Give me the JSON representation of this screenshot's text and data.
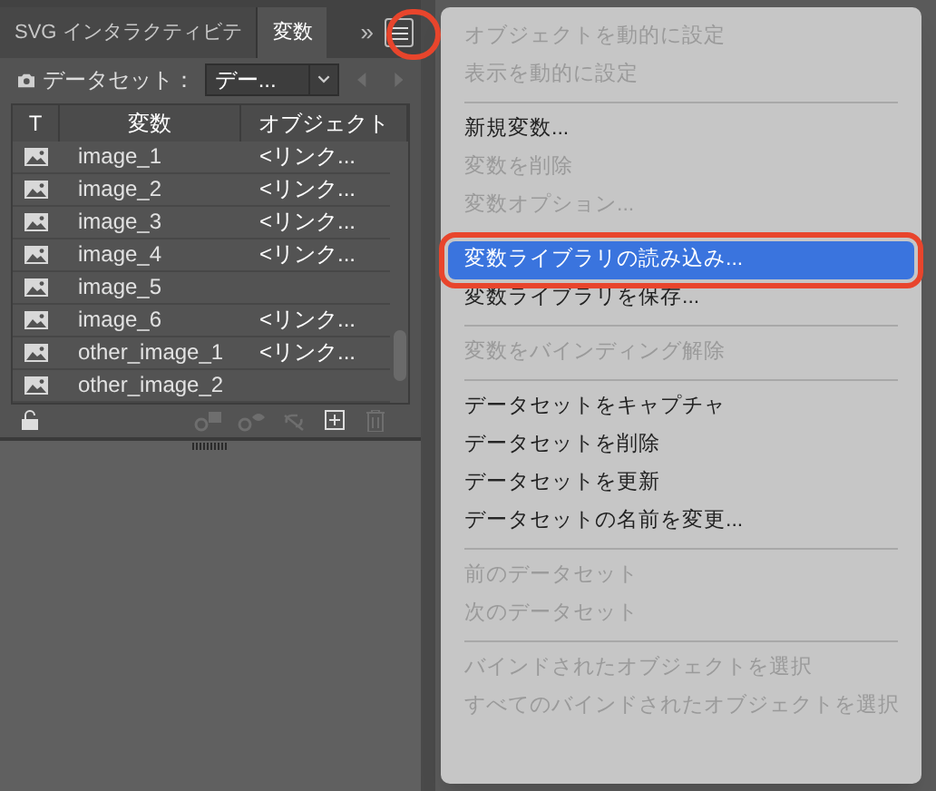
{
  "panel": {
    "tabs": [
      {
        "label": "SVG インタラクティビテ",
        "selected": false
      },
      {
        "label": "変数",
        "selected": true
      }
    ],
    "overflow": "»",
    "dataset": {
      "label": "データセット：",
      "value": "デー..."
    },
    "columns": [
      "T",
      "変数",
      "オブジェクト"
    ],
    "rows": [
      {
        "name": "image_1",
        "object": "<リンク..."
      },
      {
        "name": "image_2",
        "object": "<リンク..."
      },
      {
        "name": "image_3",
        "object": "<リンク..."
      },
      {
        "name": "image_4",
        "object": "<リンク..."
      },
      {
        "name": "image_5",
        "object": ""
      },
      {
        "name": "image_6",
        "object": "<リンク..."
      },
      {
        "name": "other_image_1",
        "object": "<リンク..."
      },
      {
        "name": "other_image_2",
        "object": ""
      }
    ]
  },
  "menu": {
    "groups": [
      [
        {
          "label": "オブジェクトを動的に設定",
          "disabled": true,
          "selected": false
        },
        {
          "label": "表示を動的に設定",
          "disabled": true,
          "selected": false
        }
      ],
      [
        {
          "label": "新規変数...",
          "disabled": false,
          "selected": false
        },
        {
          "label": "変数を削除",
          "disabled": true,
          "selected": false
        },
        {
          "label": "変数オプション...",
          "disabled": true,
          "selected": false
        }
      ],
      [
        {
          "label": "変数ライブラリの読み込み...",
          "disabled": false,
          "selected": true
        },
        {
          "label": "変数ライブラリを保存...",
          "disabled": false,
          "selected": false
        }
      ],
      [
        {
          "label": "変数をバインディング解除",
          "disabled": true,
          "selected": false
        }
      ],
      [
        {
          "label": "データセットをキャプチャ",
          "disabled": false,
          "selected": false
        },
        {
          "label": "データセットを削除",
          "disabled": false,
          "selected": false
        },
        {
          "label": "データセットを更新",
          "disabled": false,
          "selected": false
        },
        {
          "label": "データセットの名前を変更...",
          "disabled": false,
          "selected": false
        }
      ],
      [
        {
          "label": "前のデータセット",
          "disabled": true,
          "selected": false
        },
        {
          "label": "次のデータセット",
          "disabled": true,
          "selected": false
        }
      ],
      [
        {
          "label": "バインドされたオブジェクトを選択",
          "disabled": true,
          "selected": false
        },
        {
          "label": "すべてのバインドされたオブジェクトを選択",
          "disabled": true,
          "selected": false
        }
      ]
    ]
  }
}
